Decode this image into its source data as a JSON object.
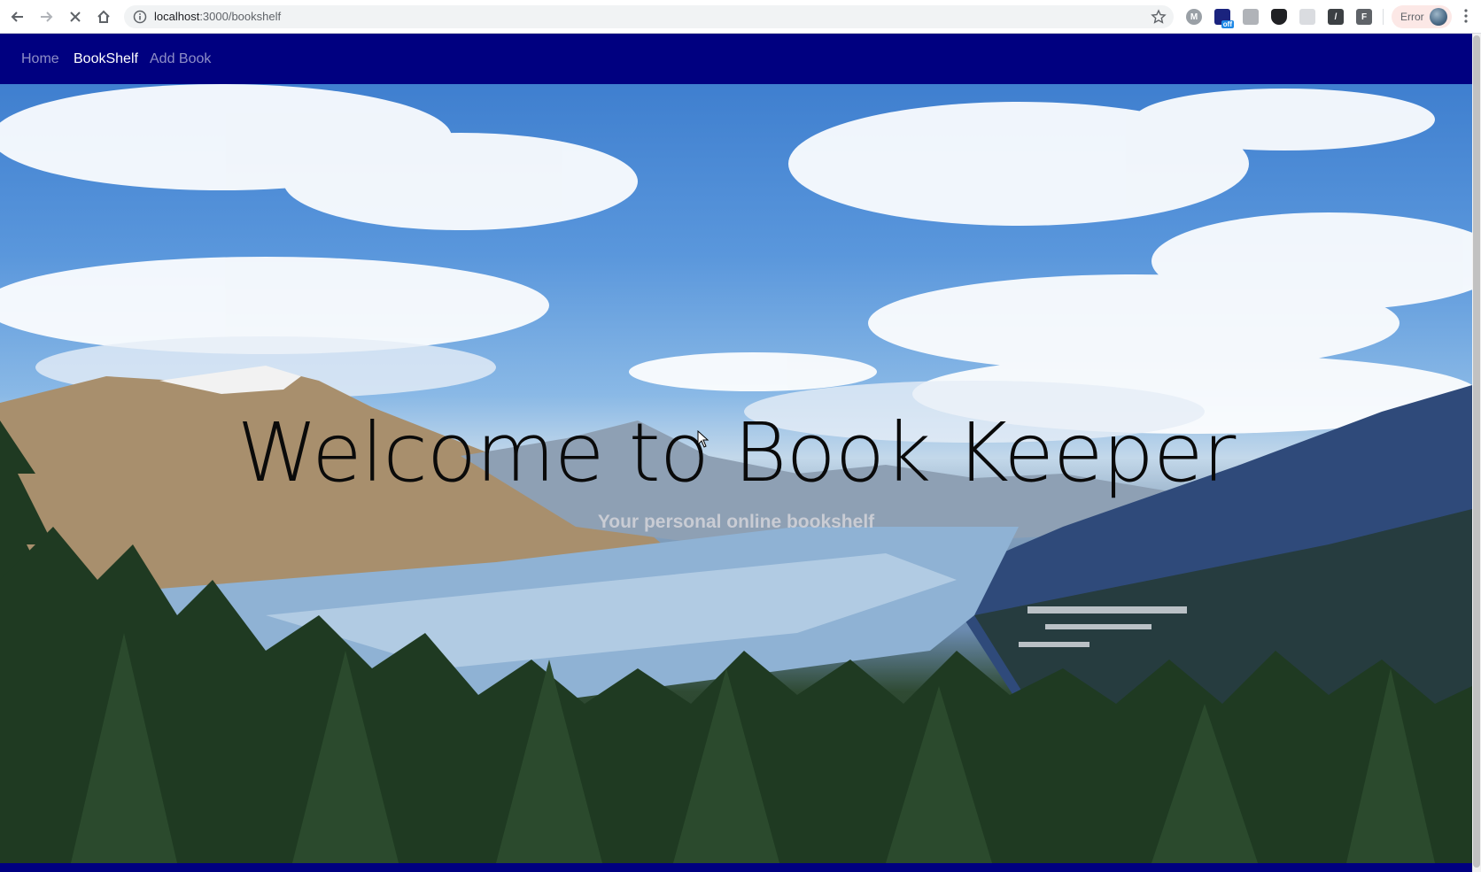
{
  "browser": {
    "url_host": "localhost",
    "url_path": ":3000/bookshelf",
    "status_chip": "Error",
    "icons": [
      "back-icon",
      "forward-icon",
      "stop-icon",
      "home-icon",
      "info-icon",
      "star-icon",
      "kebab-menu-icon"
    ],
    "extensions": [
      {
        "name": "m-extension-icon",
        "color": "#5f6368",
        "glyph": "M"
      },
      {
        "name": "off-extension-icon",
        "color": "#1a237e",
        "glyph": ""
      },
      {
        "name": "image-extension-icon",
        "color": "#9aa0a6",
        "glyph": ""
      },
      {
        "name": "shield-extension-icon",
        "color": "#202124",
        "glyph": ""
      },
      {
        "name": "tabs-extension-icon",
        "color": "#bdc1c6",
        "glyph": ""
      },
      {
        "name": "slash-extension-icon",
        "color": "#3c4043",
        "glyph": "/"
      },
      {
        "name": "f-extension-icon",
        "color": "#5f6368",
        "glyph": "F"
      }
    ]
  },
  "navbar": {
    "background": "#000080",
    "links": [
      {
        "label": "Home",
        "state": "muted"
      },
      {
        "label": "BookShelf",
        "state": "active"
      },
      {
        "label": "Add Book",
        "state": "muted"
      }
    ]
  },
  "hero": {
    "title": "Welcome to Book Keeper",
    "subtitle": "Your personal online bookshelf",
    "image": "mountain-lake-landscape"
  }
}
